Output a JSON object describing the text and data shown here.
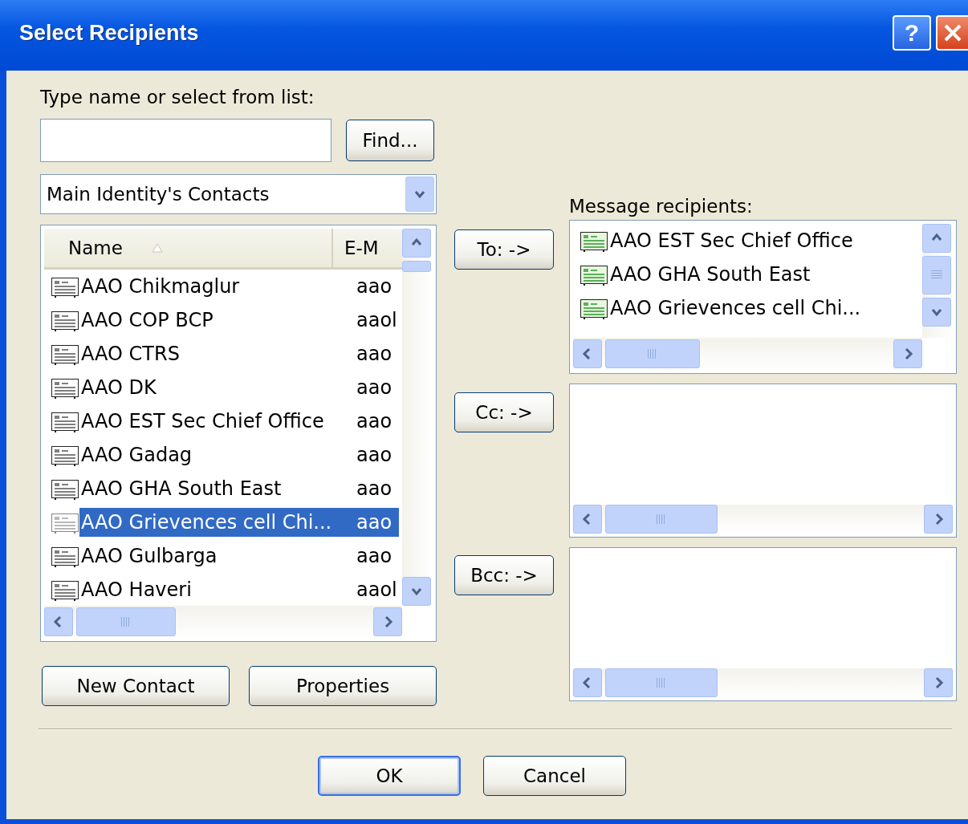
{
  "window": {
    "title": "Select Recipients",
    "help_button": "?"
  },
  "search": {
    "label": "Type name or select from list:",
    "find_button": "Find..."
  },
  "address_book": {
    "value": "Main Identity's Contacts"
  },
  "contacts": {
    "columns": [
      {
        "label": "Name",
        "sorted": true
      },
      {
        "label": "E-M",
        "sorted": false
      }
    ],
    "rows": [
      {
        "name": "AAO Chikmaglur",
        "email": "aao",
        "selected": false
      },
      {
        "name": "AAO COP BCP",
        "email": "aaol",
        "selected": false
      },
      {
        "name": "AAO CTRS",
        "email": "aao",
        "selected": false
      },
      {
        "name": "AAO DK",
        "email": "aao",
        "selected": false
      },
      {
        "name": "AAO EST Sec Chief Office",
        "email": "aao",
        "selected": false
      },
      {
        "name": "AAO Gadag",
        "email": "aao",
        "selected": false
      },
      {
        "name": "AAO GHA South East",
        "email": "aao",
        "selected": false
      },
      {
        "name": "AAO Grievences cell Chi...",
        "email": "aao",
        "selected": true
      },
      {
        "name": "AAO Gulbarga",
        "email": "aao",
        "selected": false
      },
      {
        "name": "AAO Haveri",
        "email": "aaol",
        "selected": false
      }
    ]
  },
  "contact_buttons": [
    "New Contact",
    "Properties"
  ],
  "recipients_label": "Message recipients:",
  "recipient_fields": [
    {
      "button": "To: ->",
      "entries": [
        "AAO EST Sec Chief Office",
        "AAO GHA South East",
        "AAO Grievences cell Chi..."
      ]
    },
    {
      "button": "Cc: ->"
    },
    {
      "button": "Bcc: ->"
    }
  ],
  "dialog_buttons": [
    {
      "label": "OK",
      "default": true
    },
    {
      "label": "Cancel",
      "default": false
    }
  ]
}
